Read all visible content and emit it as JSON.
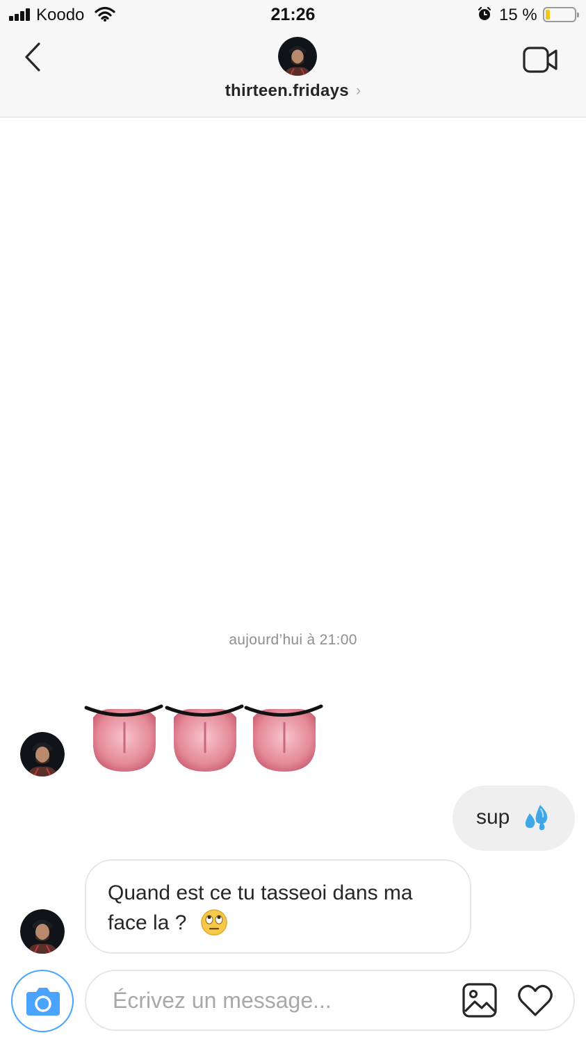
{
  "status_bar": {
    "carrier": "Koodo",
    "time": "21:26",
    "battery_percent": "15 %",
    "battery_level": 0.15,
    "battery_color": "#f5c518"
  },
  "header": {
    "username": "thirteen.fridays",
    "chevron": "›",
    "icons": [
      "back-chevron-icon",
      "video-call-icon"
    ]
  },
  "conversation": {
    "timestamp": "aujourd’hui à 21:00",
    "messages": [
      {
        "sender": "thirteen.fridays",
        "type": "emoji",
        "content": "👅👅👅"
      },
      {
        "sender": "me",
        "type": "text",
        "text": "sup",
        "emoji": "💦"
      },
      {
        "sender": "thirteen.fridays",
        "type": "text",
        "text": "Quand est ce tu tasseoi dans ma face la ?",
        "emoji": "🙄"
      }
    ]
  },
  "composer": {
    "placeholder": "Écrivez un message...",
    "icons": [
      "camera-icon",
      "gallery-icon",
      "heart-icon"
    ],
    "accent_color": "#4aa3ff"
  }
}
